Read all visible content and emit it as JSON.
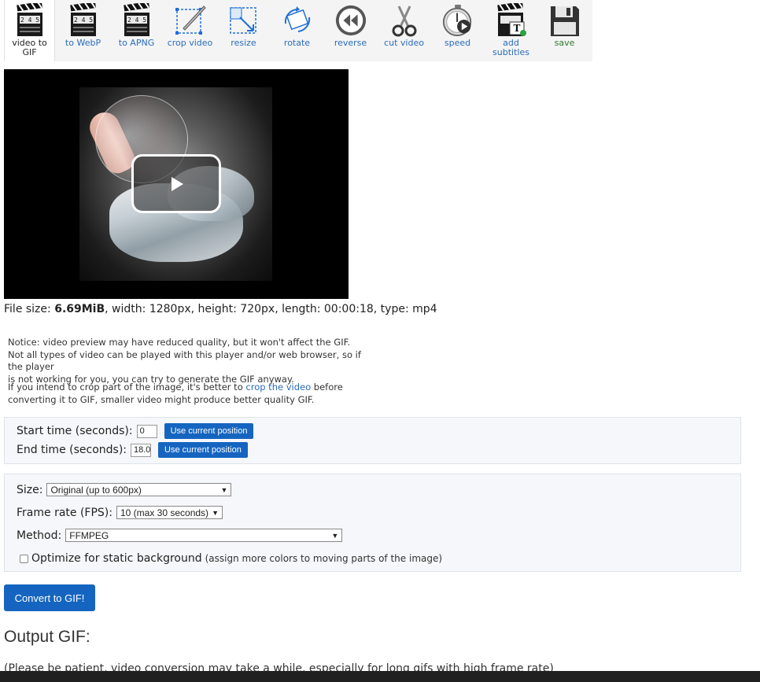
{
  "toolbar": {
    "items": [
      {
        "label": "video to GIF",
        "icon": "clapperboard-icon"
      },
      {
        "label": "to WebP",
        "icon": "clapperboard-icon"
      },
      {
        "label": "to APNG",
        "icon": "clapperboard-icon"
      },
      {
        "label": "crop video",
        "icon": "crop-icon"
      },
      {
        "label": "resize",
        "icon": "resize-icon"
      },
      {
        "label": "rotate",
        "icon": "rotate-icon"
      },
      {
        "label": "reverse",
        "icon": "rewind-icon"
      },
      {
        "label": "cut video",
        "icon": "scissors-icon"
      },
      {
        "label": "speed",
        "icon": "stopwatch-icon"
      },
      {
        "label": "add subtitles",
        "icon": "clapperboard-subtitle-icon"
      },
      {
        "label": "save",
        "icon": "floppy-disk-icon"
      }
    ]
  },
  "clapper": {
    "digits": "2 4 5"
  },
  "file_info": {
    "prefix": "File size: ",
    "size": "6.69MiB",
    "rest": ", width: 1280px, height: 720px, length: 00:00:18, type: mp4"
  },
  "notice": {
    "line1": "Notice: video preview may have reduced quality, but it won't affect the GIF.",
    "line2": "Not all types of video can be played with this player and/or web browser, so if the player",
    "line3": "is not working for you, you can try to generate the GIF anyway."
  },
  "crop_note": {
    "before": "If you intend to crop part of the image, it's better to ",
    "link": "crop the video",
    "after": " before",
    "line2": "converting it to GIF, smaller video might produce better quality GIF."
  },
  "timing": {
    "start_label": "Start time (seconds):",
    "start_value": "0",
    "end_label": "End time (seconds):",
    "end_value": "18.0",
    "use_position_label": "Use current position"
  },
  "options": {
    "size_label": "Size:",
    "size_value": "Original (up to 600px)",
    "fps_label": "Frame rate (FPS):",
    "fps_value": "10 (max 30 seconds)",
    "method_label": "Method:",
    "method_value": "FFMPEG",
    "optimize_label": "Optimize for static background",
    "optimize_note": "(assign more colors to moving parts of the image)",
    "optimize_checked": false
  },
  "convert_label": "Convert to GIF!",
  "output": {
    "title": "Output GIF:",
    "patience": "(Please be patient, video conversion may take a while, especially for long gifs with high frame rate)"
  },
  "colors": {
    "accent": "#1565c0",
    "link": "#2a6cbb",
    "save": "#2c7b2c"
  }
}
